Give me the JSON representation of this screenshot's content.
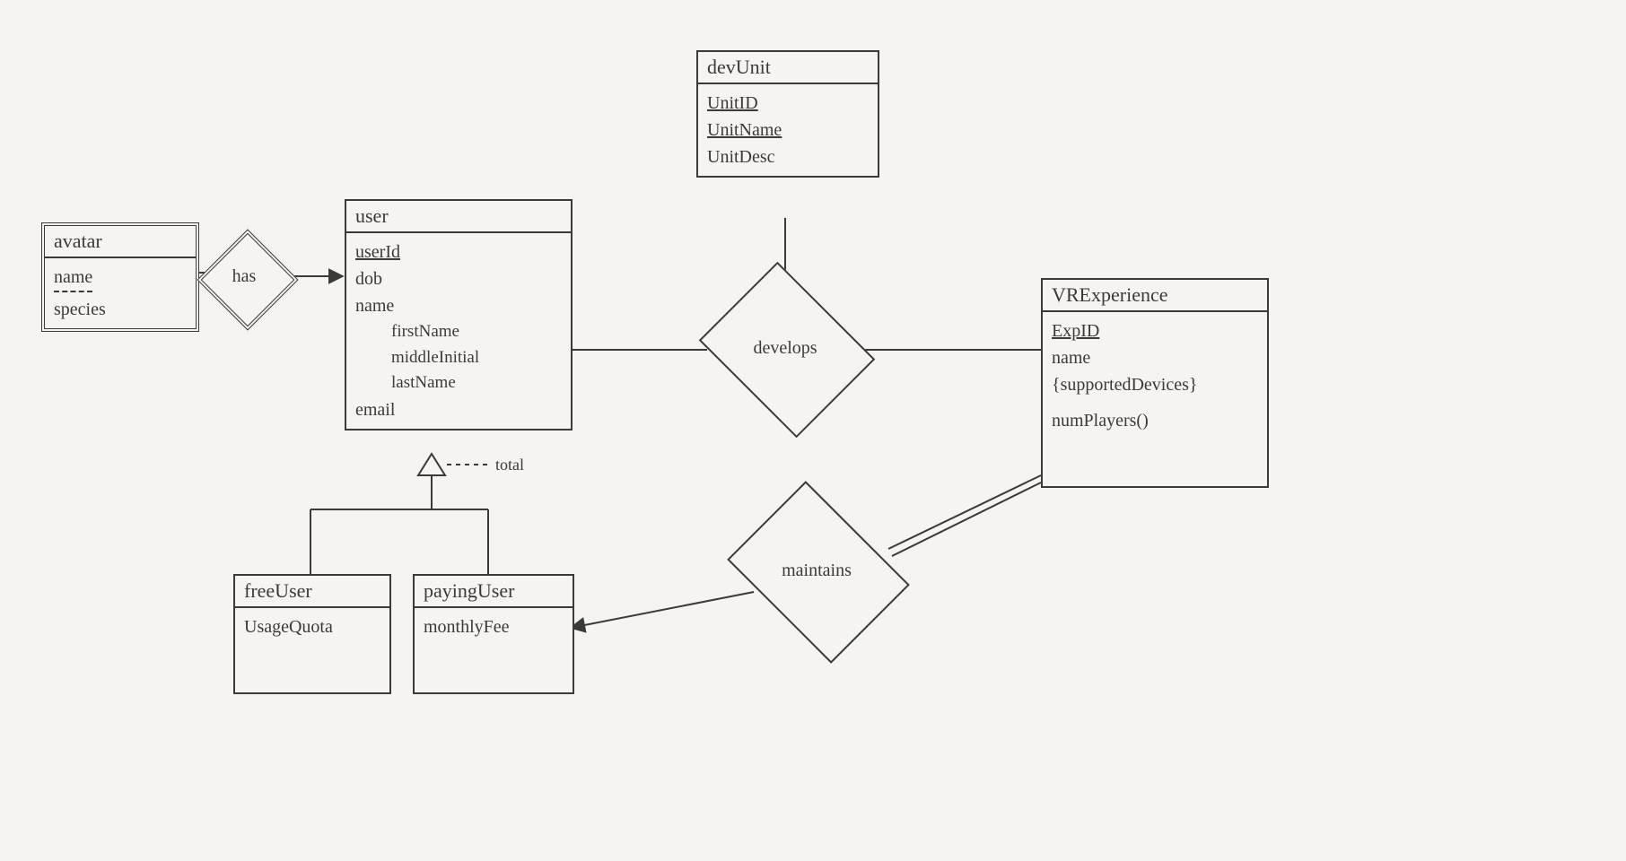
{
  "entities": {
    "avatar": {
      "title": "avatar",
      "attrs": {
        "name": "name",
        "species": "species"
      }
    },
    "user": {
      "title": "user",
      "attrs": {
        "userid": "userId",
        "dob": "dob",
        "name": "name",
        "firstName": "firstName",
        "middleInitial": "middleInitial",
        "lastName": "lastName",
        "email": "email"
      }
    },
    "devunit": {
      "title": "devUnit",
      "attrs": {
        "unitid": "UnitID",
        "unitname": "UnitName",
        "unitdesc": "UnitDesc"
      }
    },
    "vrexp": {
      "title": "VRExperience",
      "attrs": {
        "expid": "ExpID",
        "name": "name",
        "supportedDevices": "{supportedDevices}",
        "numPlayers": "numPlayers()"
      }
    },
    "freeuser": {
      "title": "freeUser",
      "attrs": {
        "usageQuota": "UsageQuota"
      }
    },
    "payinguser": {
      "title": "payingUser",
      "attrs": {
        "monthlyFee": "monthlyFee"
      }
    }
  },
  "relationships": {
    "has": "has",
    "develops": "develops",
    "maintains": "maintains"
  },
  "annotations": {
    "total": "total"
  }
}
